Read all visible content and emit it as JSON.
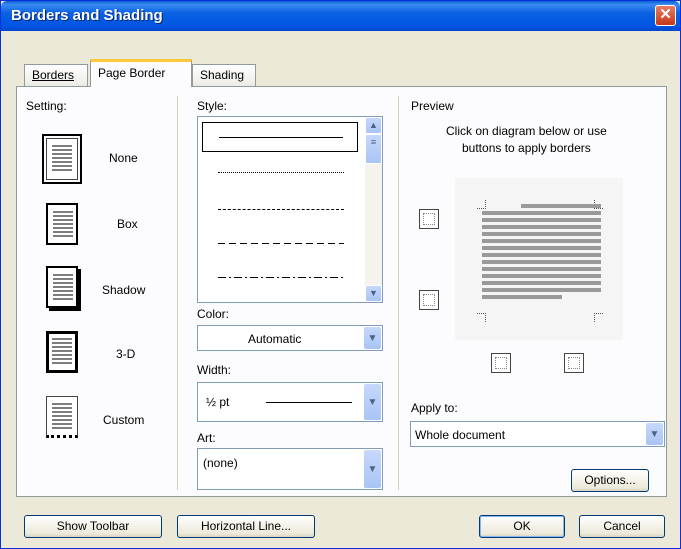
{
  "window": {
    "title": "Borders and Shading",
    "close_label": "✕"
  },
  "tabs": [
    "Borders",
    "Page Border",
    "Shading"
  ],
  "setting": {
    "label": "Setting:",
    "options": [
      "None",
      "Box",
      "Shadow",
      "3-D",
      "Custom"
    ]
  },
  "style": {
    "label": "Style:"
  },
  "color": {
    "label": "Color:",
    "value": "Automatic"
  },
  "width": {
    "label": "Width:",
    "value": "½ pt"
  },
  "art": {
    "label": "Art:",
    "value": "(none)"
  },
  "preview": {
    "label": "Preview",
    "hint_line1": "Click on diagram below or use",
    "hint_line2": "buttons to apply borders"
  },
  "apply_to": {
    "label": "Apply to:",
    "value": "Whole document"
  },
  "buttons": {
    "options": "Options...",
    "show_toolbar": "Show Toolbar",
    "horizontal_line": "Horizontal Line...",
    "ok": "OK",
    "cancel": "Cancel"
  }
}
